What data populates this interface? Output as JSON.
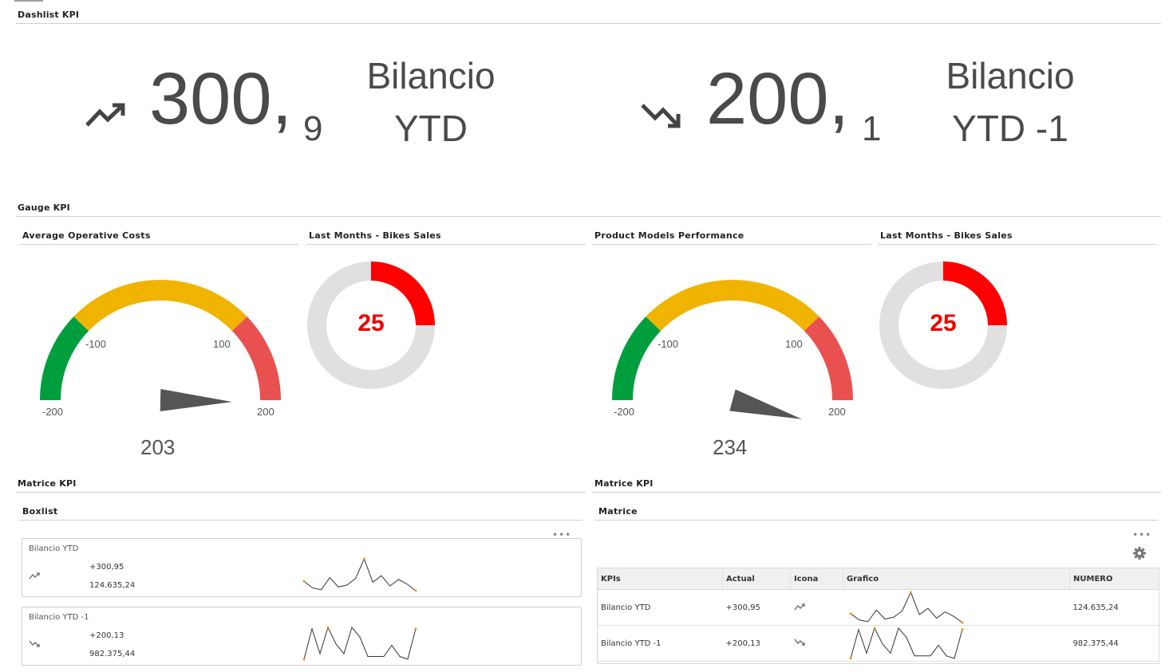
{
  "dashlist": {
    "title": "Dashlist KPI",
    "items": [
      {
        "icon": "trending-up-icon",
        "integer": "300,",
        "decimal": "9",
        "label_line1": "Bilancio",
        "label_line2": "YTD"
      },
      {
        "icon": "trending-down-icon",
        "integer": "200,",
        "decimal": "1",
        "label_line1": "Bilancio",
        "label_line2": "YTD -1"
      }
    ]
  },
  "gauge_section": {
    "title": "Gauge KPI",
    "gauges": [
      {
        "title": "Average Operative Costs",
        "value": "203",
        "needle_value": 203,
        "min": "-200",
        "max": "200",
        "tick_low": "-100",
        "tick_high": "100"
      },
      {
        "title": "Product Models Performance",
        "value": "234",
        "needle_value": 234,
        "min": "-200",
        "max": "200",
        "tick_low": "-100",
        "tick_high": "100"
      }
    ],
    "donuts": [
      {
        "title": "Last Months - Bikes Sales",
        "value": "25",
        "fraction": 0.25
      },
      {
        "title": "Last Months - Bikes Sales",
        "value": "25",
        "fraction": 0.25
      }
    ],
    "colors": {
      "green": "#009e3d",
      "yellow": "#f0b400",
      "red_arc": "#e95050",
      "donut_red": "#ff0000",
      "donut_grey": "#e0e0e0",
      "needle": "#555555"
    }
  },
  "matrice_left": {
    "title": "Matrice KPI",
    "panel_title": "Boxlist",
    "menu": "•••",
    "boxes": [
      {
        "name": "Bilancio YTD",
        "icon": "trending-up-icon",
        "value": "+300,95",
        "total": "124.635,24"
      },
      {
        "name": "Bilancio YTD -1",
        "icon": "trending-down-icon",
        "value": "+200,13",
        "total": "982.375,44"
      }
    ]
  },
  "matrice_right": {
    "title": "Matrice KPI",
    "panel_title": "Matrice",
    "menu": "•••",
    "settings_icon": "gear-icon",
    "columns": [
      "KPIs",
      "Actual",
      "Icona",
      "Grafico",
      "NUMERO"
    ],
    "rows": [
      {
        "kpi": "Bilancio YTD",
        "actual": "+300,95",
        "icon": "trending-up-icon",
        "numero": "124.635,24"
      },
      {
        "kpi": "Bilancio YTD -1",
        "actual": "+200,13",
        "icon": "trending-down-icon",
        "numero": "982.375,44"
      }
    ]
  },
  "sparklines": {
    "ytd": [
      10,
      3,
      1,
      14,
      4,
      6,
      13,
      34,
      9,
      16,
      5,
      12,
      7,
      0
    ],
    "ytd_1": [
      2,
      24,
      6,
      25,
      13,
      6,
      25,
      18,
      4,
      4,
      4,
      12,
      4,
      2,
      24
    ]
  }
}
